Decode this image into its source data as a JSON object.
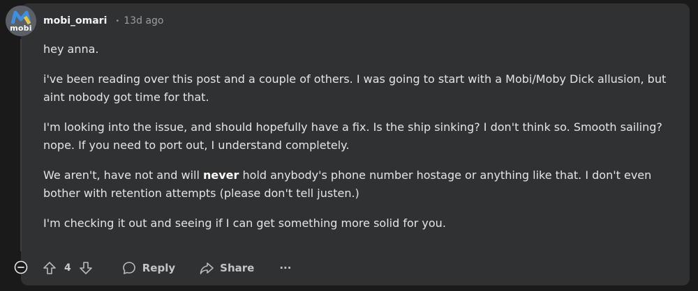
{
  "comment": {
    "author": "mobi_omari",
    "avatar_text": "mobi",
    "separator": "•",
    "time": "13d ago",
    "body": {
      "p1": "hey anna.",
      "p2": "i've been reading over this post and a couple of others. I was going to start with a Mobi/Moby Dick allusion, but aint nobody got time for that.",
      "p3": "I'm looking into the issue, and should hopefully have a fix. Is the ship sinking? I don't think so. Smooth sailing? nope. If you need to port out, I understand completely.",
      "p4_pre": "We aren't, have not and will ",
      "p4_bold": "never",
      "p4_post": " hold anybody's phone number hostage or anything like that. I don't even bother with retention attempts (please don't tell justen.)",
      "p5": "I'm checking it out and seeing if I can get something more solid for you."
    }
  },
  "actions": {
    "vote_count": "4",
    "reply_label": "Reply",
    "share_label": "Share",
    "more_label": "···"
  },
  "colors": {
    "background": "#1a1a1b",
    "card": "#2f3133",
    "text": "#e3e5e7",
    "muted": "#9a9ea3"
  },
  "icons": {
    "collapse": "minus-circle-icon",
    "upvote": "arrow-up-icon",
    "downvote": "arrow-down-icon",
    "reply": "comment-bubble-icon",
    "share": "share-arrow-icon",
    "more": "ellipsis-icon"
  }
}
